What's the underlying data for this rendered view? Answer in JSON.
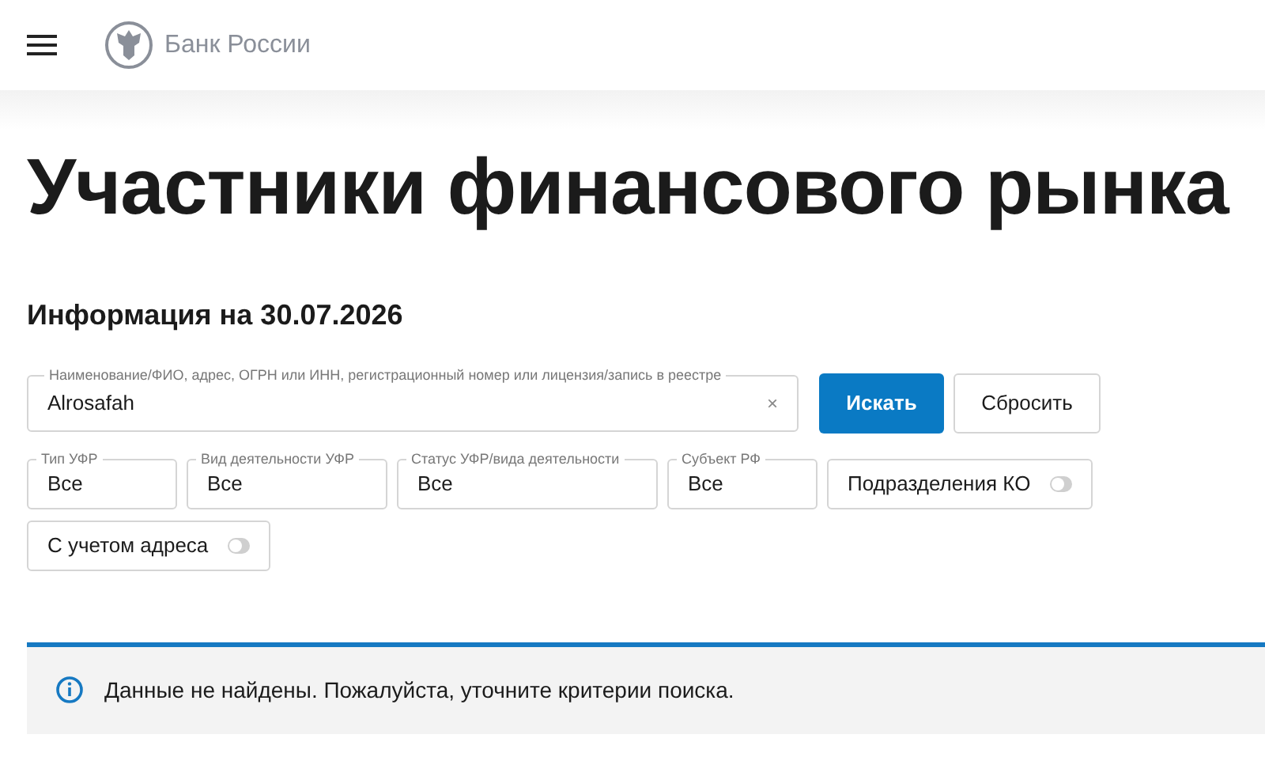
{
  "header": {
    "brand": "Банк России"
  },
  "title": "Участники финансового рынка",
  "info_date": "Информация на 30.07.2026",
  "search": {
    "label": "Наименование/ФИО, адрес, ОГРН или ИНН, регистрационный номер или лицензия/запись в реестре",
    "value": "Alrosafah",
    "clear": "×"
  },
  "buttons": [
    {
      "label": "Искать",
      "kind": "primary"
    },
    {
      "label": "Сбросить",
      "kind": "secondary"
    }
  ],
  "filters": [
    {
      "kind": "select",
      "label": "Тип УФР",
      "value": "Все"
    },
    {
      "kind": "select",
      "label": "Вид деятельности УФР",
      "value": "Все"
    },
    {
      "kind": "select",
      "label": "Статус УФР/вида деятельности",
      "value": "Все"
    },
    {
      "kind": "select",
      "label": "Субъект РФ",
      "value": "Все"
    },
    {
      "kind": "toggle",
      "label": "Подразделения КО",
      "on": false
    },
    {
      "kind": "toggle",
      "label": "С учетом адреса",
      "on": false
    }
  ],
  "alert": {
    "message": "Данные не найдены. Пожалуйста, уточните критерии поиска."
  }
}
